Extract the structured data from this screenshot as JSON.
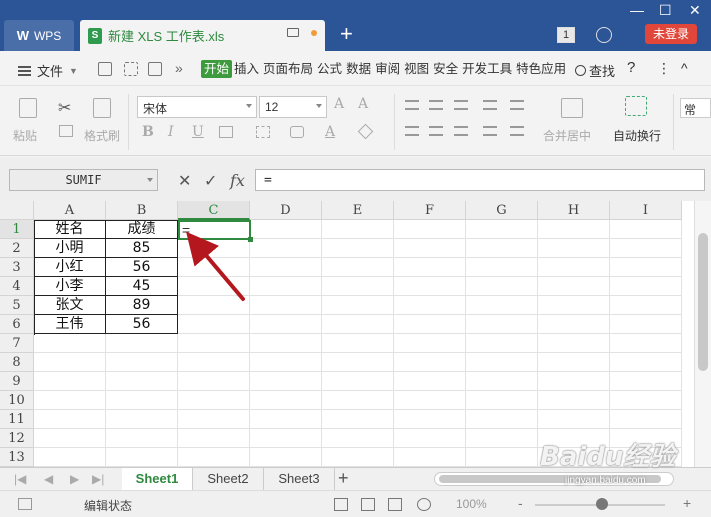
{
  "titlebar": {
    "app_tab": "WPS",
    "doc_tab": "新建 XLS 工作表.xls",
    "add_tab": "+",
    "badge": "1",
    "login": "未登录",
    "min": "—",
    "max": "☐",
    "close": "✕"
  },
  "menubar": {
    "file": "文件",
    "tabs": [
      "开始",
      "插入",
      "页面布局",
      "公式",
      "数据",
      "审阅",
      "视图",
      "安全",
      "开发工具",
      "特色应用"
    ],
    "search": "查找",
    "help": "?",
    "more": "⋮",
    "collapse": "^"
  },
  "ribbon": {
    "paste": "粘贴",
    "format_painter": "格式刷",
    "font_name": "宋体",
    "font_size": "12",
    "merge_center": "合并居中",
    "wrap_text": "自动换行",
    "general": "常"
  },
  "formula_bar": {
    "name_box": "SUMIF",
    "cancel": "✕",
    "confirm": "✓",
    "fx": "fx",
    "content": "="
  },
  "grid": {
    "columns": [
      "A",
      "B",
      "C",
      "D",
      "E",
      "F",
      "G",
      "H",
      "I"
    ],
    "rows": [
      "1",
      "2",
      "3",
      "4",
      "5",
      "6",
      "7",
      "8",
      "9",
      "10",
      "11",
      "12",
      "13"
    ],
    "table": [
      [
        "姓名",
        "成绩"
      ],
      [
        "小明",
        "85"
      ],
      [
        "小红",
        "56"
      ],
      [
        "小李",
        "45"
      ],
      [
        "张文",
        "89"
      ],
      [
        "王伟",
        "56"
      ]
    ],
    "active_cell_value": "="
  },
  "sheets": [
    "Sheet1",
    "Sheet2",
    "Sheet3"
  ],
  "sheet_add": "+",
  "status": {
    "mode": "编辑状态",
    "zoom": "100%",
    "zoom_minus": "-",
    "zoom_plus": "+"
  },
  "watermark": {
    "brand": "Baidu经验",
    "url": "jingyan.baidu.com"
  },
  "colors": {
    "titlebar": "#2b5597",
    "accent_green": "#2f8a3f",
    "login_red": "#e0463a",
    "arrow_red": "#b5171e"
  }
}
